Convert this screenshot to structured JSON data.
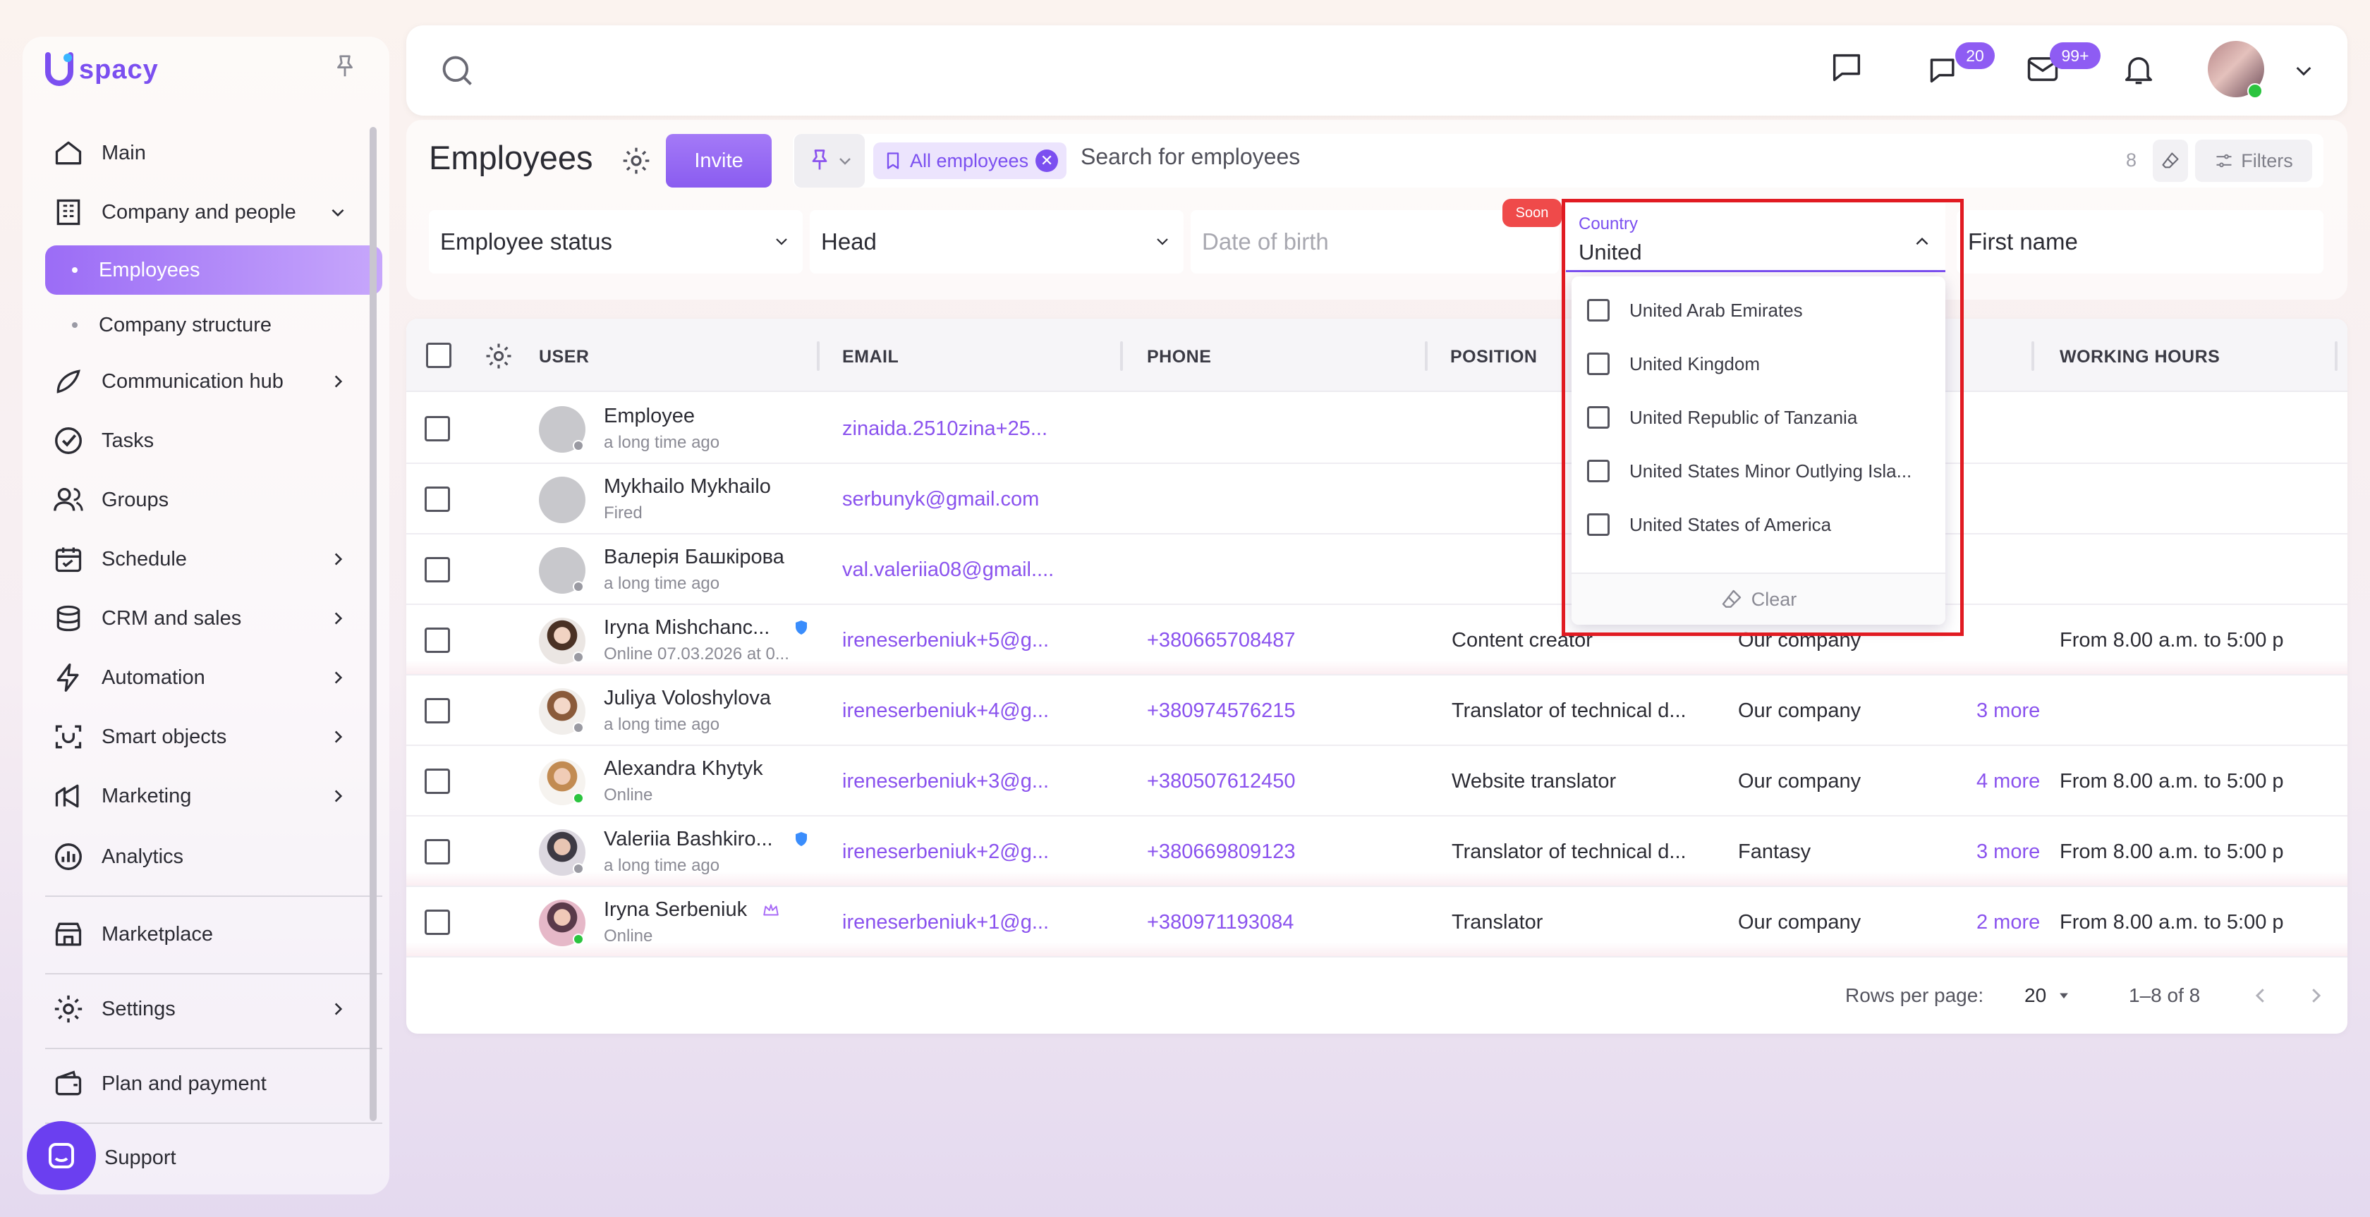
{
  "app": {
    "brand": "spacy",
    "brand_accent": "#7b4ff0"
  },
  "sidebar": {
    "items": [
      {
        "label": "Main",
        "icon": "home-icon"
      },
      {
        "label": "Company and people",
        "icon": "building-icon"
      },
      {
        "label": "Employees"
      },
      {
        "label": "Company structure"
      },
      {
        "label": "Communication hub",
        "icon": "chat-icon"
      },
      {
        "label": "Tasks",
        "icon": "check-circle-icon"
      },
      {
        "label": "Groups",
        "icon": "users-icon"
      },
      {
        "label": "Schedule",
        "icon": "calendar-icon"
      },
      {
        "label": "CRM and sales",
        "icon": "coins-icon"
      },
      {
        "label": "Automation",
        "icon": "lightning-icon"
      },
      {
        "label": "Smart objects",
        "icon": "smart-object-icon"
      },
      {
        "label": "Marketing",
        "icon": "marketing-icon"
      },
      {
        "label": "Analytics",
        "icon": "analytics-icon"
      },
      {
        "label": "Marketplace",
        "icon": "store-icon"
      },
      {
        "label": "Settings",
        "icon": "gear-icon"
      },
      {
        "label": "Plan and payment",
        "icon": "wallet-icon"
      },
      {
        "label": "Support",
        "icon": "support-chat-icon"
      }
    ]
  },
  "topbar": {
    "badge_chats": "20",
    "badge_mail": "99+"
  },
  "header": {
    "title": "Employees",
    "invite_label": "Invite",
    "chip_label": "All employees",
    "search_placeholder": "Search for employees",
    "count": "8",
    "filters_label": "Filters"
  },
  "filters": {
    "employee_status": "Employee status",
    "head": "Head",
    "date_of_birth": "Date of birth",
    "soon_badge": "Soon",
    "first_name": "First name"
  },
  "country_dropdown": {
    "label": "Country",
    "value": "United",
    "options": [
      "United Arab Emirates",
      "United Kingdom",
      "United Republic of Tanzania",
      "United States Minor Outlying Isla...",
      "United States of America"
    ],
    "clear_label": "Clear"
  },
  "table": {
    "columns": [
      "USER",
      "EMAIL",
      "PHONE",
      "POSITION",
      "WORKING HOURS"
    ],
    "rows": [
      {
        "name": "Employee",
        "sub": "a long time ago",
        "email": "zinaida.2510zina+25...",
        "phone": "",
        "position": "",
        "company": "",
        "more": "",
        "hours": ""
      },
      {
        "name": "Mykhailo Mykhailo",
        "sub": "Fired",
        "email": "serbunyk@gmail.com",
        "phone": "",
        "position": "",
        "company": "",
        "more": "",
        "hours": ""
      },
      {
        "name": "Валерія Башкірова",
        "sub": "a long time ago",
        "email": "val.valeriia08@gmail....",
        "phone": "",
        "position": "",
        "company": "",
        "more": "",
        "hours": ""
      },
      {
        "name": "Iryna Mishchanc...",
        "sub": "Online 07.03.2026 at 0...",
        "email": "ireneserbeniuk+5@g...",
        "phone": "+380665708487",
        "position": "Content creator",
        "company": "Our company",
        "more": "",
        "hours": "From 8.00 a.m. to 5:00 p"
      },
      {
        "name": "Juliya Voloshylova",
        "sub": "a long time ago",
        "email": "ireneserbeniuk+4@g...",
        "phone": "+380974576215",
        "position": "Translator of technical d...",
        "company": "Our company",
        "more": "3 more",
        "hours": ""
      },
      {
        "name": "Alexandra Khytyk",
        "sub": "Online",
        "email": "ireneserbeniuk+3@g...",
        "phone": "+380507612450",
        "position": "Website translator",
        "company": "Our company",
        "more": "4 more",
        "hours": "From 8.00 a.m. to 5:00 p"
      },
      {
        "name": "Valeriia Bashkiro...",
        "sub": "a long time ago",
        "email": "ireneserbeniuk+2@g...",
        "phone": "+380669809123",
        "position": "Translator of technical d...",
        "company": "Fantasy",
        "more": "3 more",
        "hours": "From 8.00 a.m. to 5:00 p"
      },
      {
        "name": "Iryna Serbeniuk",
        "sub": "Online",
        "email": "ireneserbeniuk+1@g...",
        "phone": "+380971193084",
        "position": "Translator",
        "company": "Our company",
        "more": "2 more",
        "hours": "From 8.00 a.m. to 5:00 p"
      }
    ]
  },
  "pagination": {
    "rows_per_page_label": "Rows per page:",
    "rows_per_page": "20",
    "range": "1–8 of 8"
  }
}
